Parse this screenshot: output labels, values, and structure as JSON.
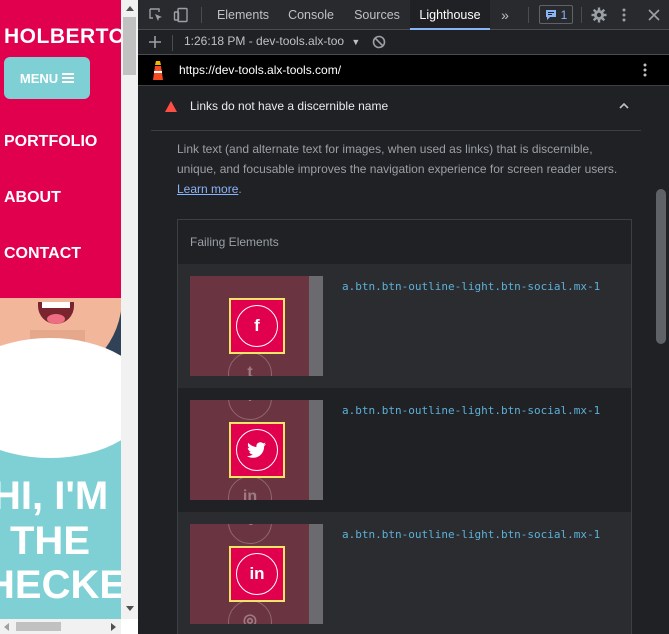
{
  "site": {
    "brand": "HOLBERTO",
    "menu_label": "MENU",
    "nav_links": [
      "PORTFOLIO",
      "ABOUT",
      "CONTACT"
    ],
    "hero_lines": [
      "HI, I'M",
      "THE",
      "HECKE"
    ],
    "colors": {
      "nav_bg": "#e0004e",
      "accent": "#7fd0d5"
    }
  },
  "devtools": {
    "tabs": [
      "Elements",
      "Console",
      "Sources",
      "Lighthouse"
    ],
    "active_tab": "Lighthouse",
    "more_tabs_icon": "»",
    "issues_count": "1",
    "subbar": {
      "report_label": "1:26:18 PM - dev-tools.alx-too",
      "dropdown_icon": "▼"
    },
    "url": "https://dev-tools.alx-tools.com/",
    "audit": {
      "title": "Links do not have a discernible name",
      "description": "Link text (and alternate text for images, when used as links) that is discernible, unique, and focusable improves the navigation experience for screen reader users.",
      "learn_more": "Learn more",
      "period": ".",
      "failing_header": "Failing Elements",
      "rows": [
        {
          "selector": "a.btn.btn-outline-light.btn-social.mx-1",
          "icon": "f",
          "icon_name": "facebook-icon"
        },
        {
          "selector": "a.btn.btn-outline-light.btn-social.mx-1",
          "icon": "🐦",
          "icon_name": "twitter-icon"
        },
        {
          "selector": "a.btn.btn-outline-light.btn-social.mx-1",
          "icon": "in",
          "icon_name": "linkedin-icon"
        }
      ],
      "colors": {
        "fail": "#ff4e42",
        "selector": "#5db0d7",
        "highlight": "#f5e66b"
      }
    }
  }
}
